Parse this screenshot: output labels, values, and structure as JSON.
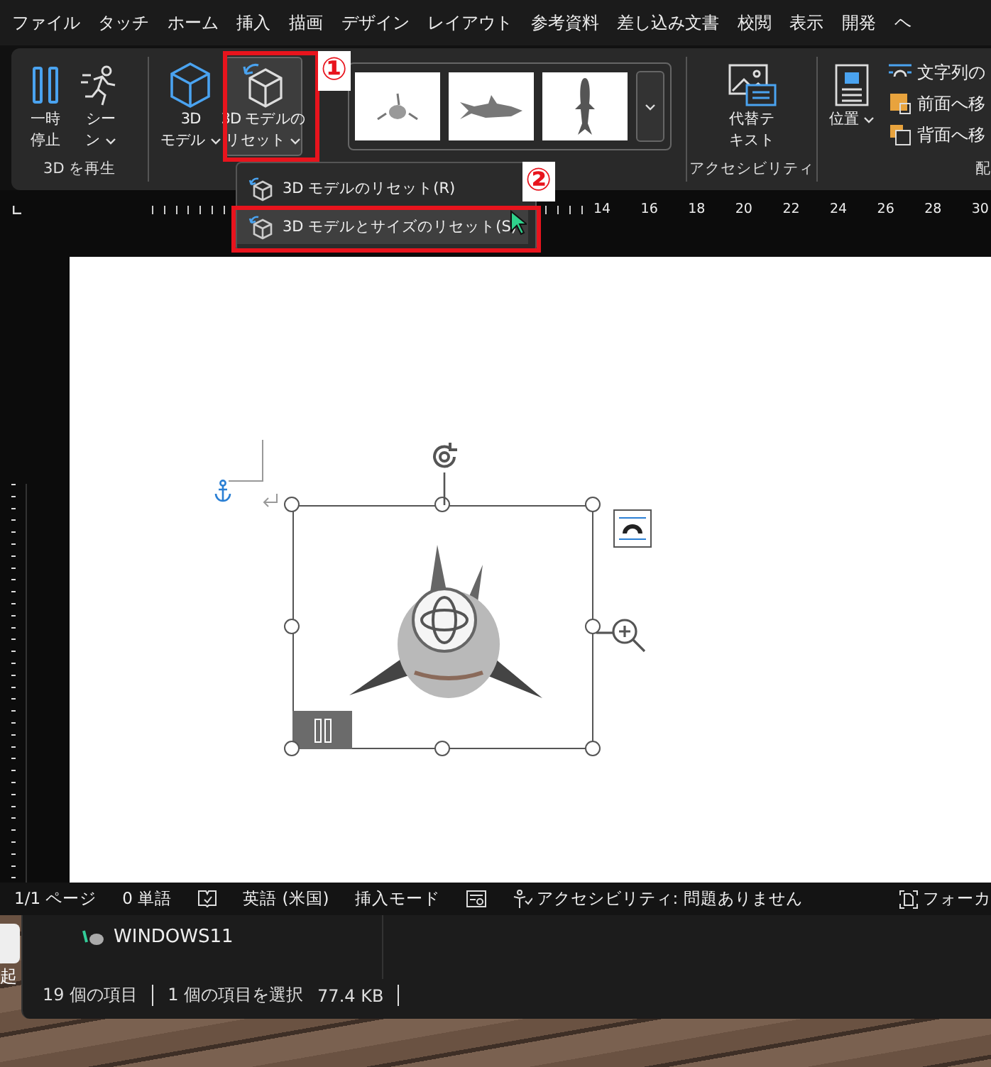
{
  "menu_tabs": [
    {
      "label": "ファイル",
      "selected": false
    },
    {
      "label": "タッチ",
      "selected": false
    },
    {
      "label": "ホーム",
      "selected": false
    },
    {
      "label": "挿入",
      "selected": false
    },
    {
      "label": "描画",
      "selected": false
    },
    {
      "label": "デザイン",
      "selected": false
    },
    {
      "label": "レイアウト",
      "selected": false
    },
    {
      "label": "参考資料",
      "selected": false
    },
    {
      "label": "差し込み文書",
      "selected": false
    },
    {
      "label": "校閲",
      "selected": false
    },
    {
      "label": "表示",
      "selected": false
    },
    {
      "label": "開発",
      "selected": false
    },
    {
      "label": "ヘ",
      "selected": false
    }
  ],
  "ribbon": {
    "play_group": {
      "label": "3D を再生",
      "buttons": [
        {
          "kind": "pause",
          "lines": [
            "一時",
            "停止"
          ],
          "dropdown": false
        },
        {
          "kind": "scene",
          "lines": [
            "シー",
            "ン"
          ],
          "dropdown": true
        }
      ]
    },
    "model_group": {
      "buttons": [
        {
          "kind": "cube",
          "lines": [
            "3D",
            "モデル"
          ],
          "dropdown": true,
          "selected": false
        },
        {
          "kind": "reset",
          "lines": [
            "3D モデルの",
            "リセット"
          ],
          "dropdown": true,
          "selected": true
        }
      ],
      "views": [
        {
          "kind": "front"
        },
        {
          "kind": "side"
        },
        {
          "kind": "top"
        }
      ]
    },
    "accessibility_group": {
      "label": "アクセシビリティ",
      "button": {
        "lines": [
          "代替テ",
          "キスト"
        ]
      }
    },
    "arrange_group": {
      "label": "配",
      "position": {
        "lines": [
          "位置"
        ],
        "dropdown": true
      },
      "commands": [
        {
          "kind": "wrap",
          "label": "文字列の"
        },
        {
          "kind": "front",
          "label": "前面へ移"
        },
        {
          "kind": "back",
          "label": "背面へ移"
        }
      ]
    }
  },
  "dropdown_menu": {
    "items": [
      {
        "label": "3D モデルのリセット(R)",
        "selected": false
      },
      {
        "label": "3D モデルとサイズのリセット(S)",
        "selected": true
      }
    ]
  },
  "annotations": [
    {
      "number": "①"
    },
    {
      "number": "②"
    }
  ],
  "ruler": {
    "numbers": [
      "14",
      "16",
      "18",
      "20",
      "22",
      "24",
      "26",
      "28",
      "30"
    ]
  },
  "status_bar": {
    "items": [
      {
        "kind": "text",
        "label": "1/1 ページ"
      },
      {
        "kind": "text",
        "label": "0 単語"
      },
      {
        "kind": "book"
      },
      {
        "kind": "text",
        "label": "英語 (米国)"
      },
      {
        "kind": "text",
        "label": "挿入モード"
      },
      {
        "kind": "macro"
      },
      {
        "kind": "accessibility",
        "label": "アクセシビリティ: 問題ありません"
      },
      {
        "kind": "focus",
        "label": "フォーカ"
      }
    ]
  },
  "explorer": {
    "items": [
      {
        "label": "WINDOWS11"
      }
    ],
    "status": [
      "19 個の項目",
      "1 個の項目を選択",
      "77.4 KB"
    ]
  },
  "desktop": {
    "icon_label": "起"
  }
}
